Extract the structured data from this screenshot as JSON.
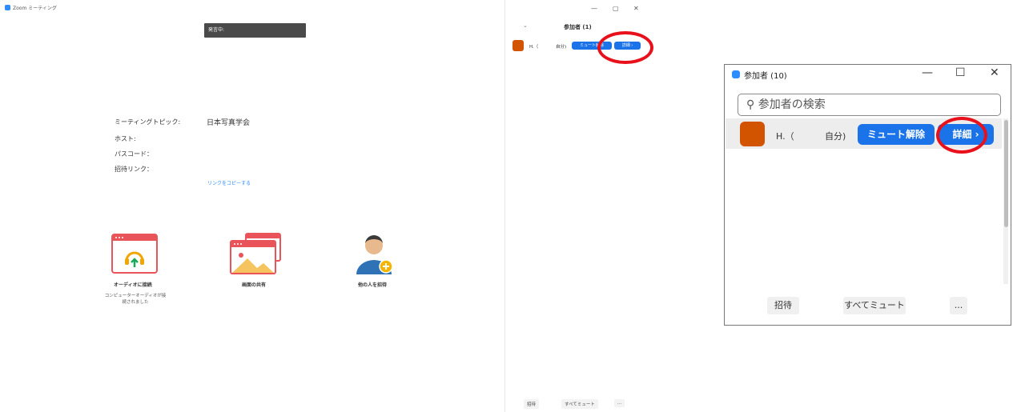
{
  "app": {
    "title": "Zoom ミーティング"
  },
  "banner": {
    "talking": "発言中:"
  },
  "meeting_info": {
    "topic_label": "ミーティングトピック:",
    "topic_value": "日本写真学会",
    "host_label": "ホスト:",
    "passcode_label": "パスコード：",
    "invite_link_label": "招待リンク：",
    "copy_link": "リンクをコピーする"
  },
  "actions": [
    {
      "label": "オーディオに接続",
      "sub1": "コンピューターオーディオが接",
      "sub2": "続されました",
      "icon": "headphone-icon"
    },
    {
      "label": "画面の共有",
      "icon": "screen-share-icon"
    },
    {
      "label": "他の人を招待",
      "icon": "invite-person-icon"
    }
  ],
  "window_controls": {
    "minimize": "—",
    "restore": "▢",
    "close": "✕"
  },
  "participants_panel": {
    "title": "参加者 (1)",
    "participant": {
      "name": "H.（",
      "self": "自分)"
    },
    "unmute_label": "ミュート解除",
    "details_label": "詳細 ›",
    "footer": {
      "invite": "招待",
      "mute_all": "すべてミュート",
      "more": "..."
    }
  },
  "zoom_panel": {
    "title": "参加者 (10)",
    "controls": {
      "minimize": "—",
      "maximize": "☐",
      "close": "✕"
    },
    "search_placeholder": "参加者の検索",
    "participant": {
      "name": "H.（",
      "self": "自分)"
    },
    "unmute_label": "ミュート解除",
    "details_label": "詳細 ›",
    "footer": {
      "invite": "招待",
      "mute_all": "すべてミュート",
      "more": "..."
    }
  },
  "colors": {
    "accent": "#1a73e8",
    "avatar": "#d35400",
    "highlight": "#e8101b",
    "action_red": "#e9545a"
  }
}
